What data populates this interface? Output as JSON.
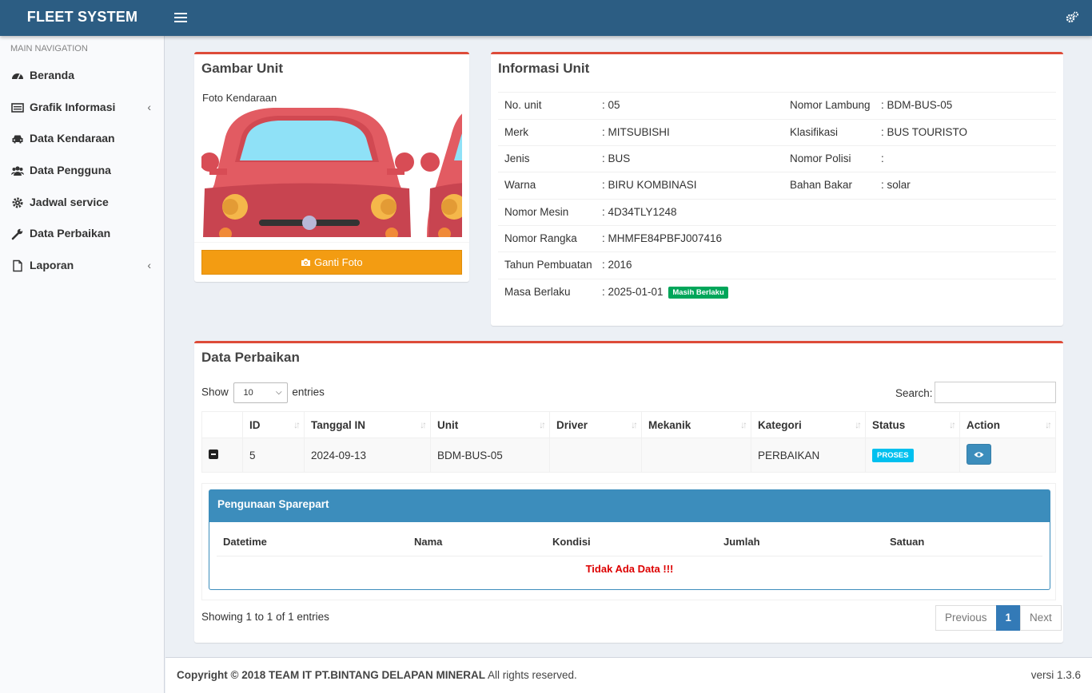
{
  "header": {
    "app_title": "FLEET SYSTEM"
  },
  "sidebar": {
    "header": "MAIN NAVIGATION",
    "items": [
      {
        "label": "Beranda",
        "icon": "dashboard-icon"
      },
      {
        "label": "Grafik Informasi",
        "icon": "list-icon",
        "expand": "‹"
      },
      {
        "label": "Data Kendaraan",
        "icon": "car-icon"
      },
      {
        "label": "Data Pengguna",
        "icon": "users-icon"
      },
      {
        "label": "Jadwal service",
        "icon": "gear-icon"
      },
      {
        "label": "Data Perbaikan",
        "icon": "wrench-icon"
      },
      {
        "label": "Laporan",
        "icon": "file-icon",
        "expand": "‹"
      }
    ]
  },
  "gambar": {
    "title": "Gambar Unit",
    "image_alt": "Foto Kendaraan",
    "button": "Ganti Foto"
  },
  "info": {
    "title": "Informasi Unit",
    "rows": [
      {
        "l1": "No. unit",
        "v1": ": 05",
        "l2": "Nomor Lambung",
        "v2": ": BDM-BUS-05"
      },
      {
        "l1": "Merk",
        "v1": ": MITSUBISHI",
        "l2": "Klasifikasi",
        "v2": ": BUS TOURISTO"
      },
      {
        "l1": "Jenis",
        "v1": ": BUS",
        "l2": "Nomor Polisi",
        "v2": ":"
      },
      {
        "l1": "Warna",
        "v1": ": BIRU KOMBINASI",
        "l2": "Bahan Bakar",
        "v2": ": solar"
      },
      {
        "l1": "Nomor Mesin",
        "v1": ": 4D34TLY1248",
        "l2": "",
        "v2": ""
      },
      {
        "l1": "Nomor Rangka",
        "v1": ": MHMFE84PBFJ007416",
        "l2": "",
        "v2": ""
      },
      {
        "l1": "Tahun Pembuatan",
        "v1": ": 2016",
        "l2": "",
        "v2": ""
      },
      {
        "l1": "Masa Berlaku",
        "v1": ": 2025-01-01",
        "l2": "",
        "v2": ""
      }
    ],
    "validity_badge": "Masih Berlaku",
    "validity_color": "#00a65a"
  },
  "perbaikan": {
    "title": "Data Perbaikan",
    "show_label": "Show",
    "entries_value": "10",
    "entries_label": "entries",
    "search_label": "Search:",
    "search_value": "",
    "columns": [
      "",
      "ID",
      "Tanggal IN",
      "Unit",
      "Driver",
      "Mekanik",
      "Kategori",
      "Status",
      "Action"
    ],
    "row": {
      "id": "5",
      "tanggal_in": "2024-09-13",
      "unit": "BDM-BUS-05",
      "driver": "",
      "mekanik": "",
      "kategori": "PERBAIKAN",
      "status": "PROSES",
      "status_color": "#00c0ef"
    },
    "sparepart": {
      "title": "Pengunaan Sparepart",
      "columns": [
        "Datetime",
        "Nama",
        "Kondisi",
        "Jumlah",
        "Satuan"
      ],
      "empty_message": "Tidak Ada Data !!!"
    },
    "info_text": "Showing 1 to 1 of 1 entries",
    "pagination": {
      "prev": "Previous",
      "page": "1",
      "next": "Next"
    }
  },
  "footer": {
    "copyright": "Copyright © 2018 TEAM IT PT.BINTANG DELAPAN MINERAL",
    "rights": "All rights reserved.",
    "version": "versi 1.3.6"
  },
  "colors": {
    "header": "#2c5d83",
    "accent_border": "#dd4b39",
    "button_orange": "#f39c12",
    "primary": "#3c8dbc"
  }
}
